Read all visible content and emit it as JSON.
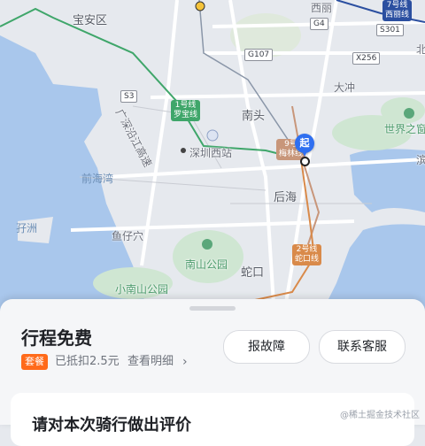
{
  "map": {
    "labels": {
      "baoan": "宝安区",
      "xili": "西丽",
      "daichong": "大冲",
      "nantou": "南头",
      "shenzhen_west": "深圳西站",
      "houhai": "后海",
      "qianhai_bay": "前海湾",
      "zizhou": "孖洲",
      "yuzaixue": "鱼仔穴",
      "nanshan_park": "南山公园",
      "shekou": "蛇口",
      "xiao_nanshan_park": "小南山公园",
      "window_of_world": "世界之窗",
      "bin": "滨",
      "bei": "北",
      "expressway": "广深沿江高速"
    },
    "road_tags": {
      "g4": "G4",
      "s301": "S301",
      "g107": "G107",
      "x256": "X256",
      "s3": "S3"
    },
    "metro_tags": {
      "line7_name": "7号线",
      "line7_station": "西丽线",
      "line1_name": "1号线",
      "line1_station": "罗宝线",
      "line9_name": "9号",
      "line9_station": "梅林线",
      "line2_name": "2号线",
      "line2_station": "蛇口线"
    },
    "start_marker": "起",
    "colors": {
      "land": "#e6e9ee",
      "water": "#a9c7ec",
      "green": "#cfe6d2",
      "line7": "#2b4fa0",
      "line1": "#3fa66a",
      "line9": "#c8967a",
      "line2": "#d98a4a",
      "start_pin": "#2f6ff0"
    }
  },
  "panel": {
    "title": "行程免费",
    "badge": "套餐",
    "discount_text": "已抵扣2.5元",
    "detail_link": "查看明细",
    "report_button": "报故障",
    "contact_button": "联系客服",
    "rate_prompt": "请对本次骑行做出评价",
    "watermark": "@稀土掘金技术社区",
    "accent_color": "#ff6a1a"
  }
}
